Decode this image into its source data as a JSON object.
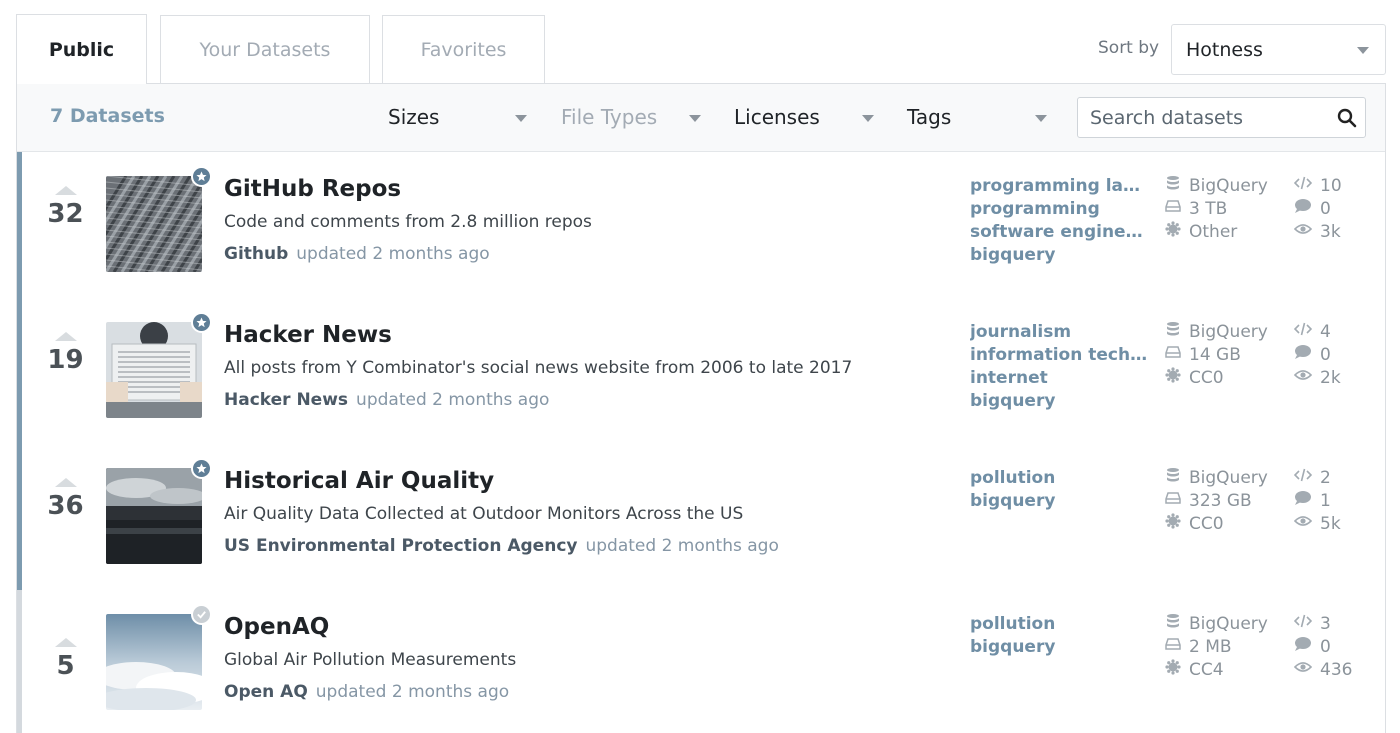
{
  "tabs": {
    "public": "Public",
    "yours": "Your Datasets",
    "favorites": "Favorites"
  },
  "sort": {
    "label": "Sort by",
    "value": "Hotness"
  },
  "toolbar": {
    "count": "7 Datasets",
    "sizes": "Sizes",
    "file_types": "File Types",
    "licenses": "Licenses",
    "tags": "Tags",
    "search_placeholder": "Search datasets"
  },
  "datasets": [
    {
      "votes": "32",
      "title": "GitHub Repos",
      "description": "Code and comments from 2.8 million repos",
      "owner": "Github",
      "updated": "updated 2 months ago",
      "badge": "star-icon",
      "tags": [
        "programming lang...",
        "programming",
        "software engineer...",
        "bigquery"
      ],
      "source": "BigQuery",
      "size": "3 TB",
      "license": "Other",
      "kernels": "10",
      "comments": "0",
      "views": "3k"
    },
    {
      "votes": "19",
      "title": "Hacker News",
      "description": "All posts from Y Combinator's social news website from 2006 to late 2017",
      "owner": "Hacker News",
      "updated": "updated 2 months ago",
      "badge": "star-icon",
      "tags": [
        "journalism",
        "information techn...",
        "internet",
        "bigquery"
      ],
      "source": "BigQuery",
      "size": "14 GB",
      "license": "CC0",
      "kernels": "4",
      "comments": "0",
      "views": "2k"
    },
    {
      "votes": "36",
      "title": "Historical Air Quality",
      "description": "Air Quality Data Collected at Outdoor Monitors Across the US",
      "owner": "US Environmental Protection Agency",
      "updated": "updated 2 months ago",
      "badge": "star-icon",
      "tags": [
        "pollution",
        "bigquery"
      ],
      "source": "BigQuery",
      "size": "323 GB",
      "license": "CC0",
      "kernels": "2",
      "comments": "1",
      "views": "5k"
    },
    {
      "votes": "5",
      "title": "OpenAQ",
      "description": "Global Air Pollution Measurements",
      "owner": "Open AQ",
      "updated": "updated 2 months ago",
      "badge": "check-icon",
      "tags": [
        "pollution",
        "bigquery"
      ],
      "source": "BigQuery",
      "size": "2 MB",
      "license": "CC4",
      "kernels": "3",
      "comments": "0",
      "views": "436"
    }
  ],
  "colors": {
    "accent": "#7d9bb0",
    "tag": "#6f8ea5",
    "muted": "#8b939a"
  }
}
